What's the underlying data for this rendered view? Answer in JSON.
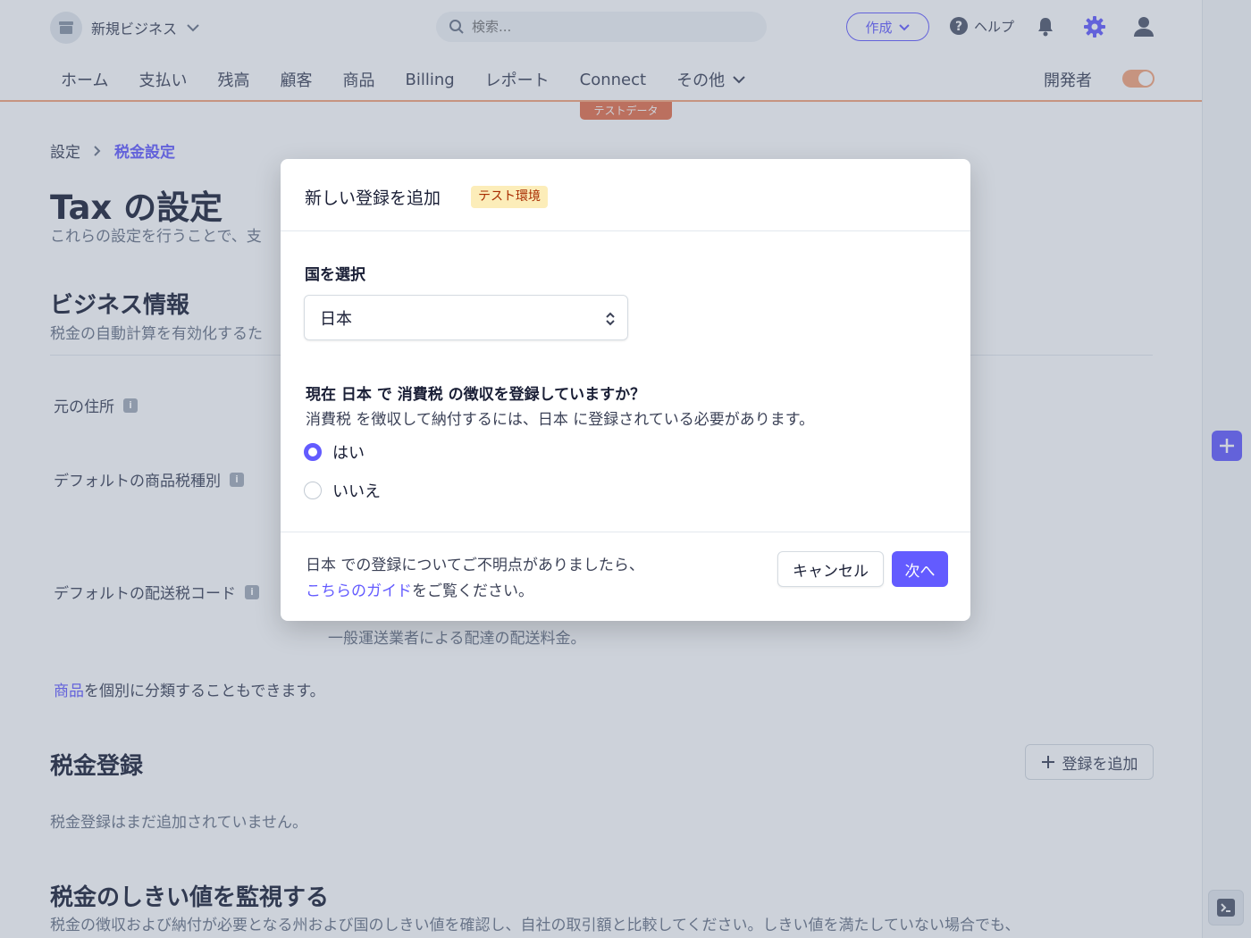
{
  "topbar": {
    "business_name": "新規ビジネス",
    "search_placeholder": "検索...",
    "create_label": "作成",
    "help_label": "ヘルプ"
  },
  "nav": {
    "items": [
      "ホーム",
      "支払い",
      "残高",
      "顧客",
      "商品",
      "Billing",
      "レポート",
      "Connect",
      "その他"
    ],
    "developer_label": "開発者",
    "test_data_badge": "テストデータ"
  },
  "page": {
    "breadcrumb_root": "設定",
    "breadcrumb_current": "税金設定",
    "title": "Tax の設定",
    "subtitle": "これらの設定を行うことで、支",
    "business_info_title": "ビジネス情報",
    "business_info_sub": "税金の自動計算を有効化するた",
    "origin_address_label": "元の住所",
    "default_product_tax_label": "デフォルトの商品税種別",
    "default_shipping_tax_label": "デフォルトの配送税コード",
    "shipping_desc": "一般運送業者による配達の配送料金。",
    "classify_link": "商品",
    "classify_text": "を個別に分類することもできます。",
    "tax_reg_title": "税金登録",
    "add_reg_button": "登録を追加",
    "tax_reg_empty": "税金登録はまだ追加されていません。",
    "threshold_title": "税金のしきい値を監視する",
    "threshold_sub": "税金の徴収および納付が必要となる州および国のしきい値を確認し、自社の取引額と比較してください。しきい値を満たしていない場合でも、"
  },
  "modal": {
    "title": "新しい登録を追加",
    "env_badge": "テスト環境",
    "country_label": "国を選択",
    "country_value": "日本",
    "question": "現在 日本 で 消費税 の徴収を登録していますか？",
    "question_sub": "消費税 を徴収して納付するには、日本 に登録されている必要があります。",
    "option_yes": "はい",
    "option_no": "いいえ",
    "selected": "はい",
    "footer_text_1": "日本 での登録についてご不明点がありましたら、",
    "footer_link": "こちらのガイド",
    "footer_text_2": "をご覧ください。",
    "cancel_label": "キャンセル",
    "next_label": "次へ"
  },
  "colors": {
    "accent": "#635bff",
    "test_mode": "#e56f4a",
    "badge_bg": "#fcedb9",
    "badge_text": "#a82c00"
  },
  "icons": [
    "store-icon",
    "chevron-down-icon",
    "search-icon",
    "help-icon",
    "bell-icon",
    "gear-icon",
    "user-icon",
    "chevron-right-icon",
    "info-icon",
    "plus-icon",
    "select-caret-icon",
    "terminal-icon"
  ]
}
